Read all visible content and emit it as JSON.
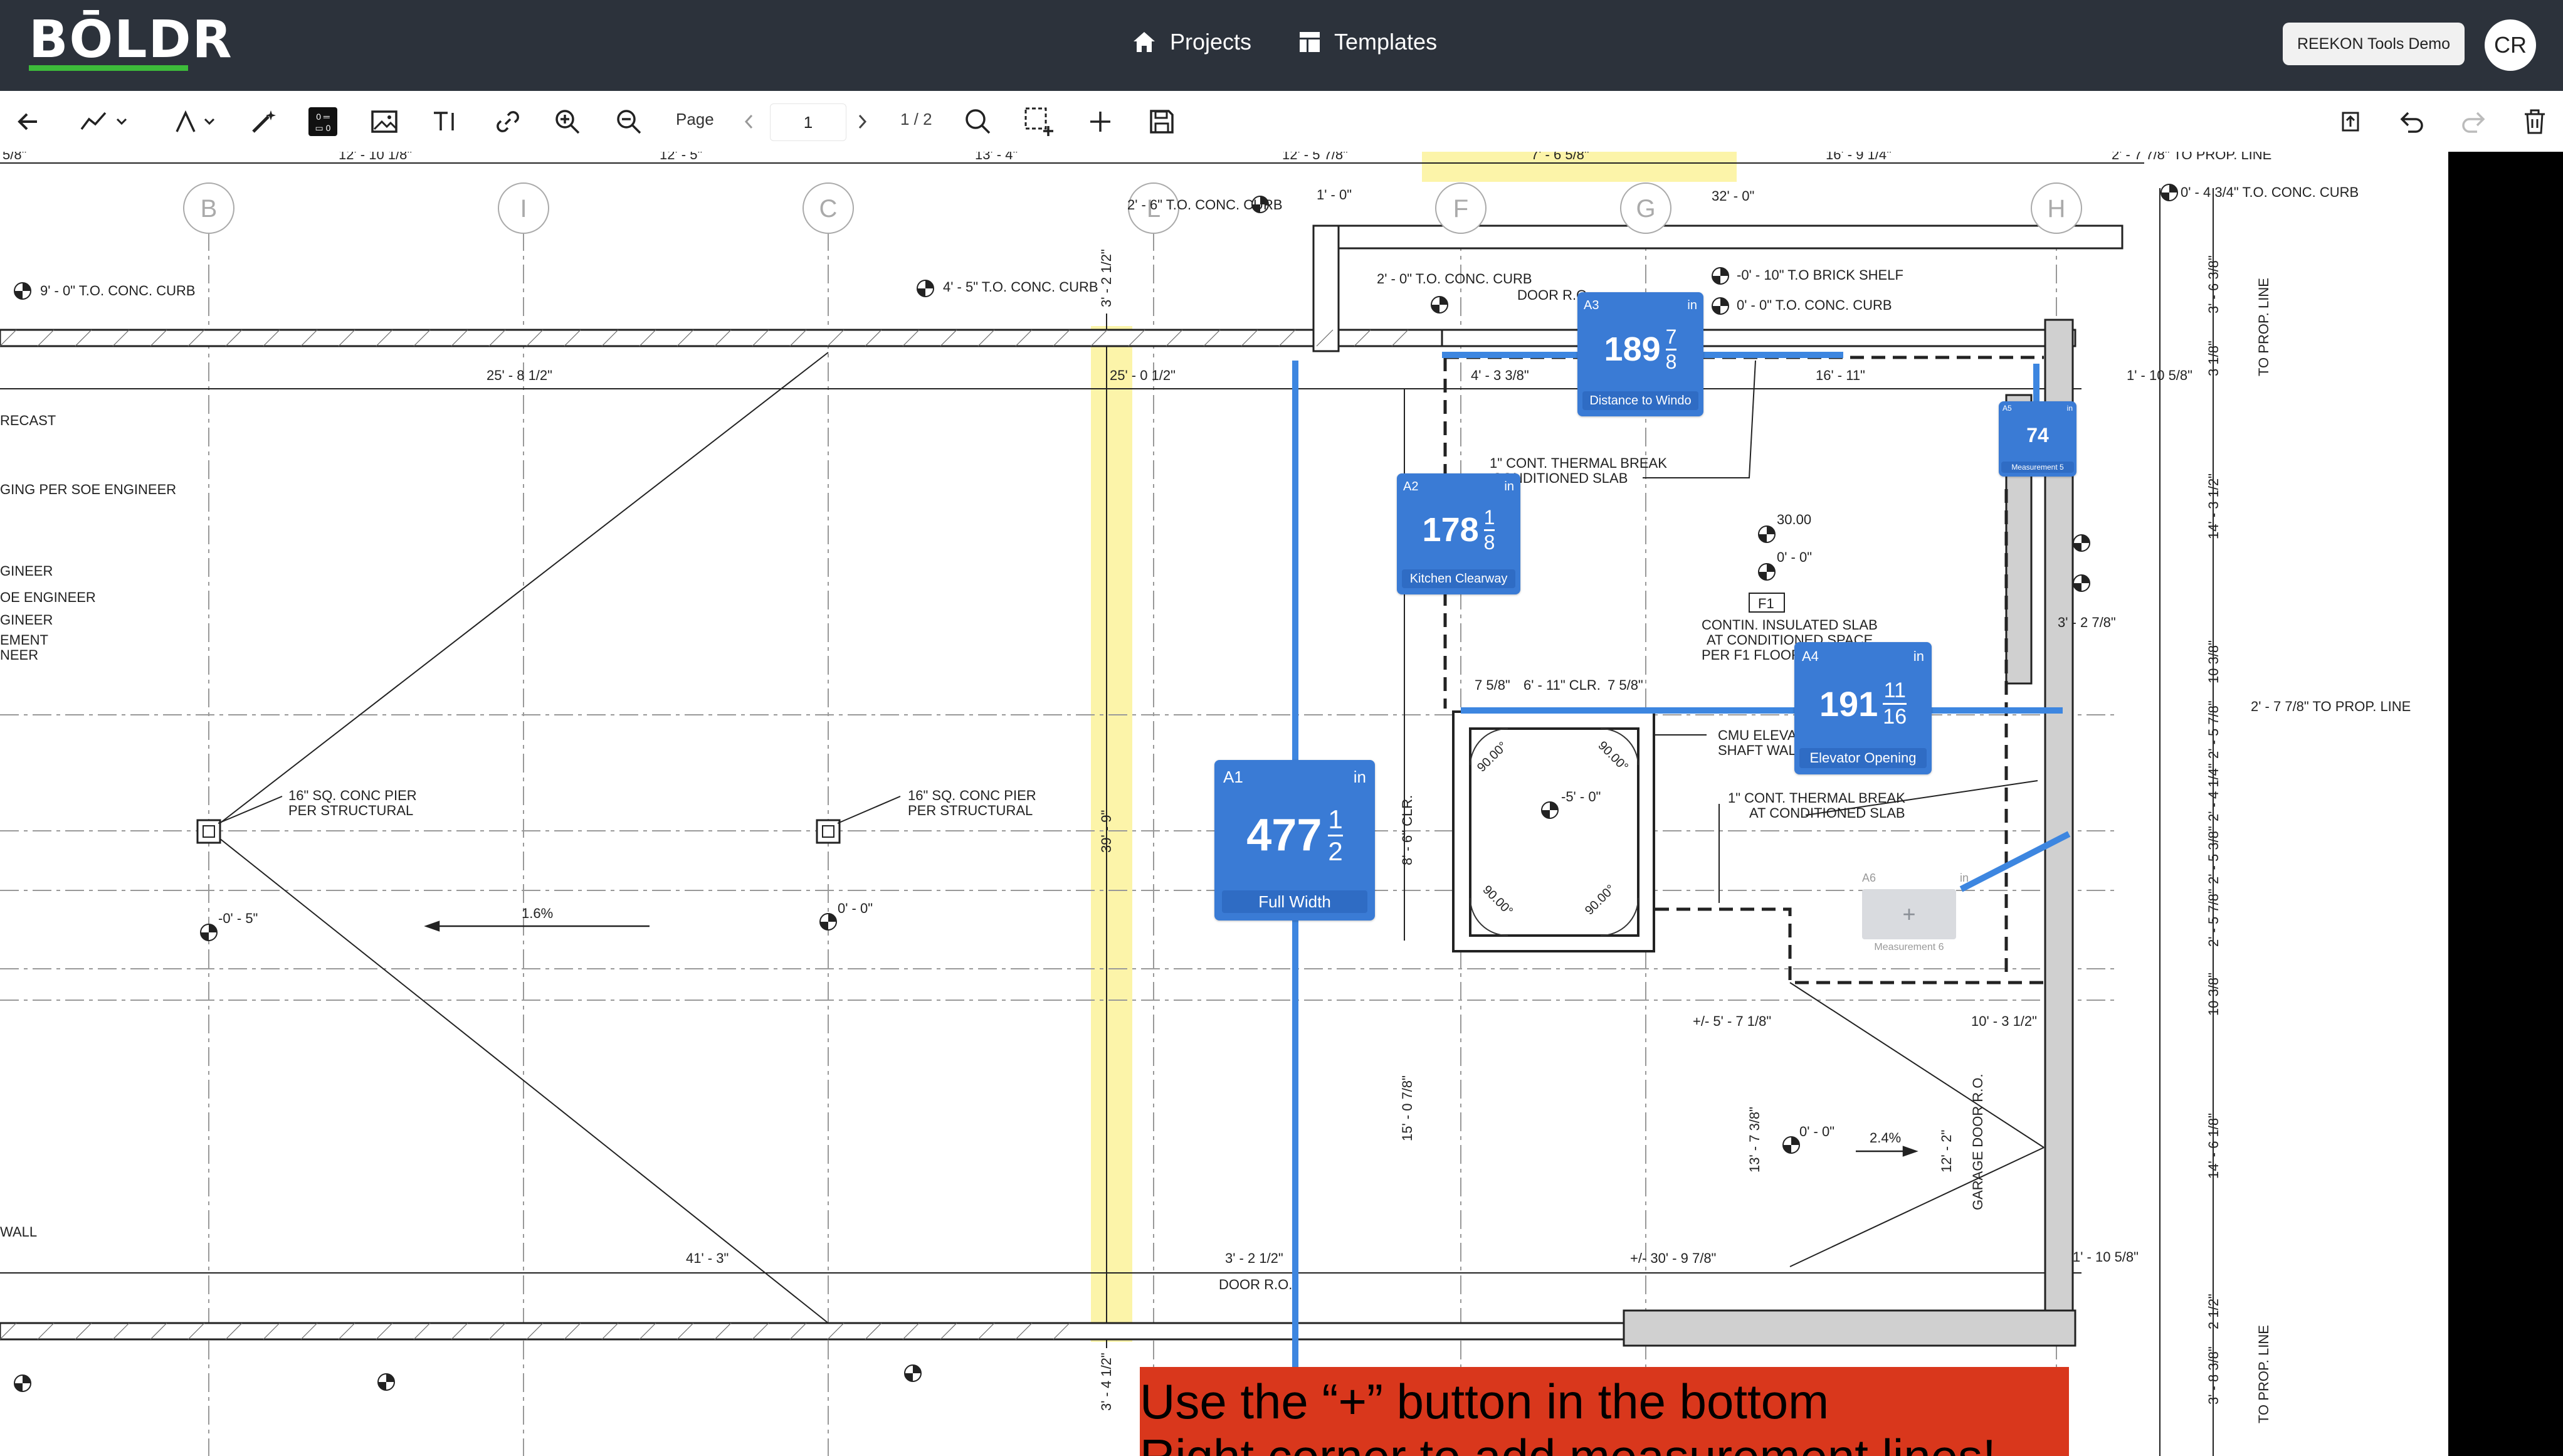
{
  "app": {
    "logo": "BŌLDR"
  },
  "nav": {
    "projects": "Projects",
    "templates": "Templates"
  },
  "header": {
    "demo_button": "REEKON Tools Demo",
    "avatar_initials": "CR"
  },
  "toolbar": {
    "page_label": "Page",
    "page_value": "1",
    "page_count": "1 / 2"
  },
  "measurements": [
    {
      "id": "A1",
      "unit": "in",
      "whole": "477",
      "num": "1",
      "den": "2",
      "label": "Full Width"
    },
    {
      "id": "A2",
      "unit": "in",
      "whole": "178",
      "num": "1",
      "den": "8",
      "label": "Kitchen Clearway"
    },
    {
      "id": "A3",
      "unit": "in",
      "whole": "189",
      "num": "7",
      "den": "8",
      "label": "Distance to Windo"
    },
    {
      "id": "A4",
      "unit": "in",
      "whole": "191",
      "num": "11",
      "den": "16",
      "label": "Elevator Opening"
    },
    {
      "id": "A5",
      "unit": "in",
      "whole": "74",
      "num": "",
      "den": "",
      "label": "Measurement 5"
    },
    {
      "id": "A6",
      "unit": "in",
      "whole": "+",
      "num": "",
      "den": "",
      "label": "Measurement 6"
    }
  ],
  "plan": {
    "grid_labels": [
      "B",
      "I",
      "C",
      "L",
      "F",
      "G",
      "H"
    ],
    "top_dims": [
      "5/8\"",
      "12' - 10 1/8\"",
      "12' - 5\"",
      "13' - 4\"",
      "12' - 5 7/8\"",
      "7' - 6 5/8\"",
      "16' - 9 1/4\"",
      "2' - 7 7/8\" TO PROP. LINE"
    ],
    "notes": {
      "to_conc_curb_9": "9' - 0\" T.O. CONC. CURB",
      "to_conc_curb_4_5": "4' - 5\" T.O. CONC. CURB",
      "to_conc_curb_2_6": "2' - 6\" T.O. CONC. CURB",
      "to_conc_curb_2_0": "2' - 0\" T.O. CONC. CURB",
      "to_conc_curb_0_4": "0' - 4 3/4\" T.O. CONC. CURB",
      "brick_shelf_10": "-0' - 10\" T.O BRICK SHELF",
      "conc_curb_0": "0' - 0\" T.O. CONC. CURB",
      "door_ro": "DOOR R.O.",
      "precast": "RECAST",
      "shoring": "GING PER SOE ENGINEER",
      "engineer1": "GINEER",
      "engineer2": "OE ENGINEER",
      "engineer3": "GINEER",
      "ement": "EMENT",
      "neer": "NEER",
      "pier1": "16\" SQ. CONC PIER",
      "pier1b": "PER STRUCTURAL",
      "slope1": "1.6%",
      "slope2": "2.4%",
      "thermal1": "1\" CONT. THERMAL BREAK",
      "thermal1b": "CONDITIONED SLAB",
      "thermal2": "1\" CONT. THERMAL BREAK",
      "thermal2b": "AT CONDITIONED SLAB",
      "cmu": "CMU ELEVATOR",
      "cmu_b": "SHAFT WALL",
      "contin1": "CONTIN. INSULATED SLAB",
      "contin2": "AT CONDITIONED SPACE",
      "contin3": "PER F1 FLOOR AS",
      "f1": "F1",
      "elev_30": "30.00",
      "elev_0": "0' - 0\"",
      "elev_neg5": "-5' - 0\"",
      "elev_neg05": "-0' - 5\"",
      "ang90": "90.00°",
      "clr": "6' - 11\" CLR.",
      "dim_7_58": "7 5/8\"",
      "dim_25": "25' - 0 1/2\"",
      "dim_25b": "25' - 8 1/2\"",
      "dim_39": "39' - 9\"",
      "dim_41": "41' - 3\"",
      "dim_30": "+/- 30' - 9 7/8\"",
      "dim_3_2": "3' - 2 1/2\"",
      "dim_3_4": "3' - 4 1/2\"",
      "dim_4_3": "4' - 3 3/8\"",
      "dim_16": "16' - 11\"",
      "dim_1_10": "1' - 10 5/8\"",
      "dim_10_3": "10' - 3 1/2\"",
      "dim_5_7": "+/- 5' - 7 1/8\"",
      "dim_15": "15' - 0 7/8\"",
      "dim_8_6": "8' - 6\" CLR.",
      "dim_13_7": "13' - 7 3/8\"",
      "dim_12_2": "12' - 2\"",
      "dim_32": "32' - 0\"",
      "dim_1_0": "1' - 0\"",
      "dim_3_2_78": "3' - 2 7/8\"",
      "garage": "GARAGE DOOR R.O.",
      "wall": "WALL",
      "prop_line": "TO PROP. LINE",
      "right_dims": [
        "3' - 6 3/8\"",
        "3 1/8\"",
        "14' - 3 1/2\"",
        "10 3/8\"",
        "2' - 5 7/8\"",
        "2' - 4 1/4\"",
        "2' - 5 3/8\"",
        "2' - 5 7/8\"",
        "10 3/8\"",
        "14' - 6 1/8\"",
        "2 1/2\"",
        "3' - 8 3/8\""
      ]
    }
  },
  "banner": {
    "line1": "Use the “+” button in the bottom",
    "line2": "Right corner to add measurement lines!"
  },
  "colors": {
    "topbar": "#2c323b",
    "accent": "#3a7bd5",
    "logo_green": "#3dbb3a",
    "highlight": "#fbf29a",
    "banner": "#d9371c"
  }
}
